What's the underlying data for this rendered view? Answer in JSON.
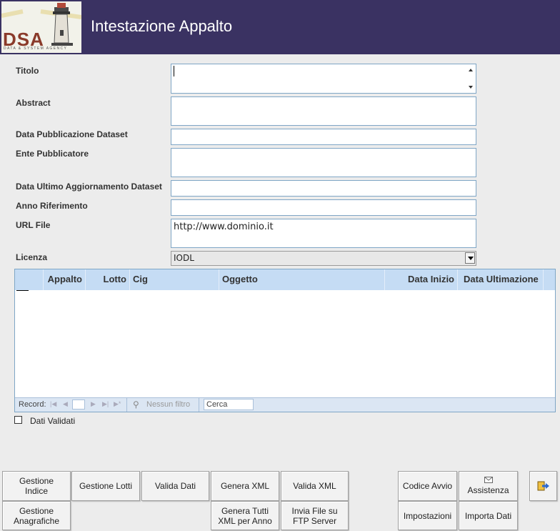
{
  "header": {
    "title": "Intestazione Appalto",
    "logo_text": "DSA",
    "logo_subtitle": "DATA & SYSTEM AGENCY"
  },
  "form": {
    "titolo_label": "Titolo",
    "titolo_value": "",
    "abstract_label": "Abstract",
    "abstract_value": "",
    "data_pubblicazione_label": "Data Pubblicazione Dataset",
    "data_pubblicazione_value": "",
    "ente_label": "Ente Pubblicatore",
    "ente_value": "",
    "data_aggiornamento_label": "Data Ultimo Aggiornamento Dataset",
    "data_aggiornamento_value": "",
    "anno_label": "Anno Riferimento",
    "anno_value": "",
    "url_label": "URL File",
    "url_value": "http://www.dominio.it",
    "licenza_label": "Licenza",
    "licenza_value": "IODL"
  },
  "grid": {
    "columns": [
      "Appalto",
      "Lotto",
      "Cig",
      "Oggetto",
      "Data Inizio",
      "Data Ultimazione"
    ],
    "rows": [],
    "nav": {
      "record_label": "Record:",
      "nessun_filtro": "Nessun filtro",
      "search_placeholder": "Cerca"
    }
  },
  "checkbox": {
    "label": "Dati Validati",
    "checked": false
  },
  "buttons": {
    "gestione_indice": "Gestione\nIndice",
    "gestione_lotti": "Gestione Lotti",
    "valida_dati": "Valida Dati",
    "genera_xml": "Genera XML",
    "valida_xml": "Valida XML",
    "codice_avvio": "Codice Avvio",
    "assistenza": "Assistenza",
    "gestione_anagrafiche": "Gestione\nAnagrafiche",
    "genera_tutti": "Genera Tutti\nXML per Anno",
    "invia_file": "Invia File su\nFTP Server",
    "impostazioni": "Impostazioni",
    "importa_dati": "Importa Dati"
  },
  "icons": {
    "exit": "exit-door-icon",
    "email": "envelope-icon",
    "filter": "filter-icon",
    "logo": "lighthouse-icon"
  },
  "colors": {
    "header_bg": "#3a3262",
    "grid_header_bg": "#c5dcf4",
    "field_border": "#7fa6c6",
    "logo_brand": "#8a3a2a"
  }
}
